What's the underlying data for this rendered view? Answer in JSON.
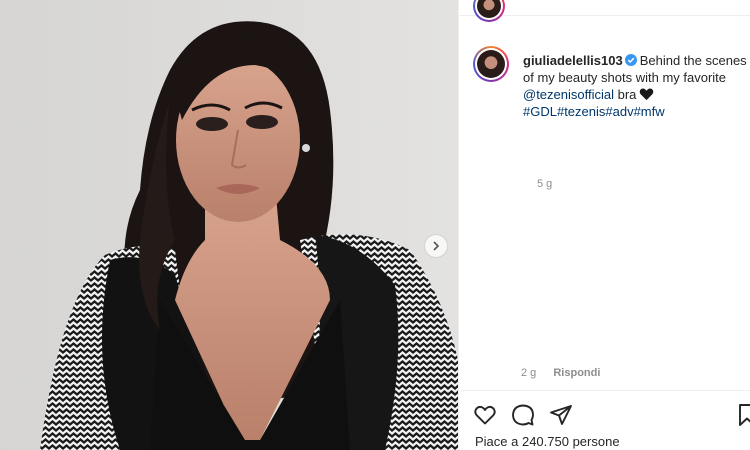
{
  "post": {
    "username": "giuliadelellis103",
    "caption_text": "Behind the scenes of my beauty shots with my favorite",
    "mention": "@tezenisofficial",
    "after_mention": "bra",
    "hashtags": "#GDL#tezenis#adv#mfw",
    "time_ago": "5 g"
  },
  "comment": {
    "time_ago": "2 g",
    "reply_label": "Rispondi"
  },
  "actions": {
    "icons": [
      "heart-icon",
      "comment-icon",
      "share-icon",
      "bookmark-icon"
    ]
  },
  "likes": {
    "text": "Piace a 240.750 persone"
  },
  "colors": {
    "link": "#00376b",
    "verified": "#3897f0",
    "meta": "#8e8e8e",
    "text": "#262626"
  }
}
